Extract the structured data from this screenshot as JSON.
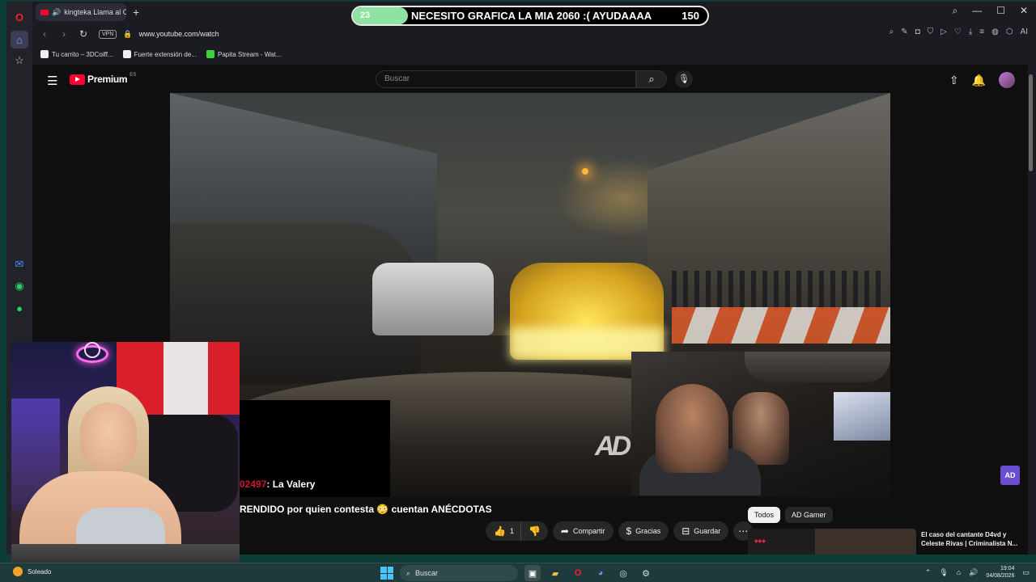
{
  "stream_overlay": {
    "goal_current": "23",
    "goal_text": "NECESITO GRAFICA LA MIA 2060 :( AYUDAAAA",
    "goal_target": "150",
    "progress": 0.15
  },
  "browser": {
    "tab_title": "kingteka Llama al CEV",
    "vpn_label": "VPN",
    "url": "www.youtube.com/watch",
    "bookmarks": [
      {
        "label": "Tu carrito – 3DCoiff..."
      },
      {
        "label": "Fuerte extensión de..."
      },
      {
        "label": "Papita Stream - Wat..."
      }
    ],
    "ai_label": "AI"
  },
  "youtube": {
    "brand": "Premium",
    "region": "ES",
    "search_placeholder": "Buscar",
    "video_watermark": "AD",
    "corner_badge": "AD",
    "chat_uid": "02497",
    "chat_msg": ": La Valery",
    "video_title": "RENDIDO por quien contesta 😳 cuentan ANÉCDOTAS",
    "actions": {
      "like_count": "1",
      "share": "Compartir",
      "thanks": "Gracias",
      "save": "Guardar"
    },
    "chips": [
      "Todos",
      "AD Gamer"
    ],
    "recommendation": {
      "title": "El caso del cantante D4vd y Celeste Rivas | Criminalista N..."
    }
  },
  "taskbar": {
    "weather": "Soleado",
    "search_label": "Buscar",
    "time": "19:04",
    "date": "04/08/2026"
  },
  "colors": {
    "accent_green": "#8ee3a2",
    "yt_red": "#ff0033",
    "taskbar_bg": "#1f3a3a"
  }
}
